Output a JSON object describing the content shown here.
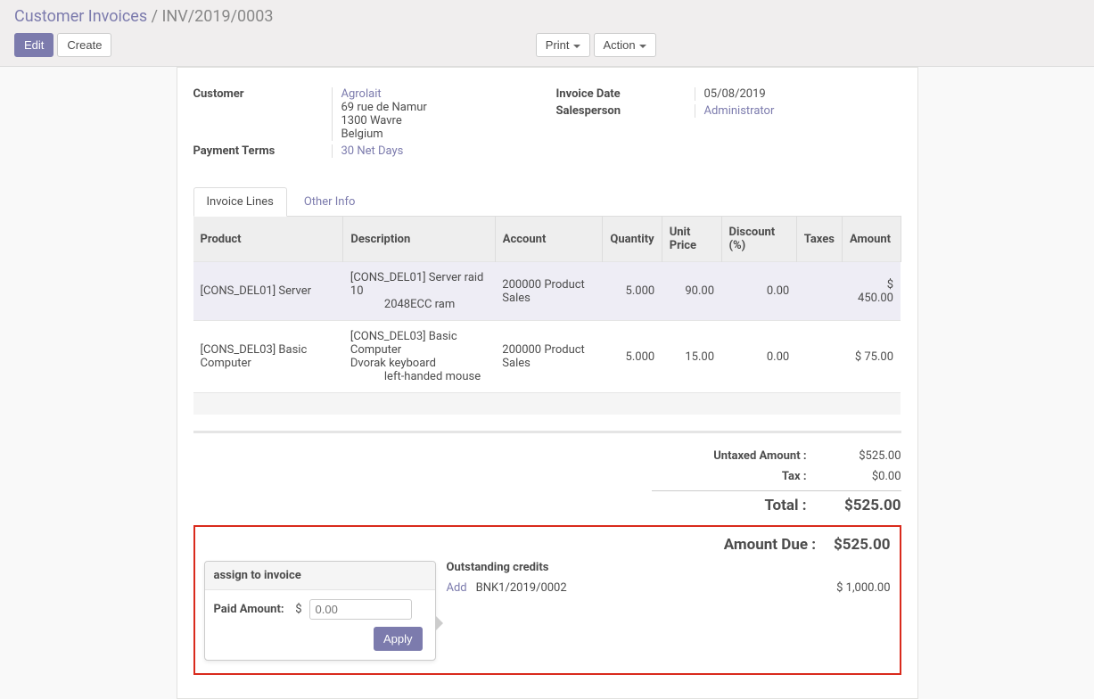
{
  "breadcrumb": {
    "parent": "Customer Invoices",
    "sep": "/",
    "current": "INV/2019/0003"
  },
  "buttons": {
    "edit": "Edit",
    "create": "Create",
    "print": "Print",
    "action": "Action"
  },
  "fields": {
    "customer_label": "Customer",
    "customer_link": "Agrolait",
    "customer_addr1": "69 rue de Namur",
    "customer_addr2": "1300 Wavre",
    "customer_addr3": "Belgium",
    "payment_terms_label": "Payment Terms",
    "payment_terms_value": "30 Net Days",
    "invoice_date_label": "Invoice Date",
    "invoice_date_value": "05/08/2019",
    "salesperson_label": "Salesperson",
    "salesperson_value": "Administrator"
  },
  "tabs": {
    "invoice_lines": "Invoice Lines",
    "other_info": "Other Info"
  },
  "columns": {
    "product": "Product",
    "description": "Description",
    "account": "Account",
    "quantity": "Quantity",
    "unit_price": "Unit Price",
    "discount": "Discount (%)",
    "taxes": "Taxes",
    "amount": "Amount"
  },
  "lines": [
    {
      "product": "[CONS_DEL01] Server",
      "desc1": "[CONS_DEL01] Server raid 10",
      "desc2": "2048ECC ram",
      "account": "200000 Product Sales",
      "qty": "5.000",
      "price": "90.00",
      "discount": "0.00",
      "taxes": "",
      "amount": "$ 450.00"
    },
    {
      "product": "[CONS_DEL03] Basic Computer",
      "desc1": "[CONS_DEL03] Basic Computer",
      "desc2": "Dvorak keyboard",
      "desc3": "left-handed mouse",
      "account": "200000 Product Sales",
      "qty": "5.000",
      "price": "15.00",
      "discount": "0.00",
      "taxes": "",
      "amount": "$ 75.00"
    }
  ],
  "totals": {
    "untaxed_label": "Untaxed Amount :",
    "untaxed_value": "$525.00",
    "tax_label": "Tax :",
    "tax_value": "$0.00",
    "total_label": "Total :",
    "total_value": "$525.00"
  },
  "amount_due": {
    "label": "Amount Due :",
    "value": "$525.00"
  },
  "popover": {
    "title": "assign to invoice",
    "paid_label": "Paid Amount:",
    "currency": "$",
    "placeholder": "0.00",
    "apply": "Apply"
  },
  "outstanding": {
    "title": "Outstanding credits",
    "add": "Add",
    "ref": "BNK1/2019/0002",
    "amount": "$ 1,000.00"
  }
}
